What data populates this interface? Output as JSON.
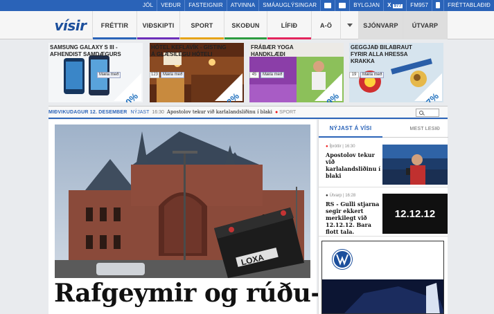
{
  "topbar": {
    "links": [
      "JÓL",
      "VEÐUR",
      "FASTEIGNIR",
      "ATVINNA",
      "SMÁAUGLÝSINGAR",
      "BYLGJAN",
      "X",
      "977",
      "FM957",
      "FRÉTTABLAÐIÐ"
    ]
  },
  "brand": {
    "logo_text": "vísir",
    "accent": "#2a63b8",
    "logo_color": "#1c4f9c"
  },
  "nav": {
    "items": [
      {
        "label": "FRÉTTIR",
        "color": "#2a63b8"
      },
      {
        "label": "VIÐSKIPTI",
        "color": "#6c2eb9"
      },
      {
        "label": "SPORT",
        "color": "#e6a317"
      },
      {
        "label": "SKOÐUN",
        "color": "#2c9b3f"
      },
      {
        "label": "LÍFIÐ",
        "color": "#e3245c"
      },
      {
        "label": "A-Ö",
        "color": ""
      }
    ],
    "dropdown_icon": "chevron-down-icon",
    "secondary": [
      "SJÓNVARP",
      "ÚTVARP"
    ]
  },
  "promos": [
    {
      "title": "SAMSUNG GALAXY S III - AFHENDIST SAMDÆGURS",
      "like": "Mæla með",
      "count": "",
      "pct": "10%"
    },
    {
      "title": "HÓTEL KEFLAVÍK - GISTING Á GLÆSILEGU HÓTELI",
      "like": "Mæla með",
      "count": "123",
      "pct": "62%"
    },
    {
      "title": "FRÁBÆR YOGA HANDKLÆÐI",
      "like": "Mæla með",
      "count": "45",
      "pct": "49%"
    },
    {
      "title": "GEGGJAÐ BILABRAUT FYRIR ALLA HRESSA KRAKKA",
      "like": "Mæla með",
      "count": "19",
      "pct": "57%"
    }
  ],
  "dateline": {
    "date": "MIÐVIKUDAGUR 12. DESEMBER",
    "label": "NÝJAST",
    "time": "16:30",
    "headline": "Apostolov tekur við karlalandsliðinu í blaki",
    "category": "SPORT"
  },
  "main": {
    "headline": "Rafgeymir og rúðu-",
    "battery_brand": "LOXA"
  },
  "sidebar": {
    "tab_active": "NÝJAST Á VÍSI",
    "tab_other": "MEST LESIÐ",
    "news": [
      {
        "meta": "Íþróttir | 16:30",
        "text": "Apostolov tekur við karlalandsliðinu í blaki"
      },
      {
        "meta": "Útvarp | 16:28",
        "text": "RS - Gulli stjarna segir ekkert merkilegt við 12.12.12. Bara flott tala.",
        "thumb_text": "12.12.12"
      }
    ]
  }
}
